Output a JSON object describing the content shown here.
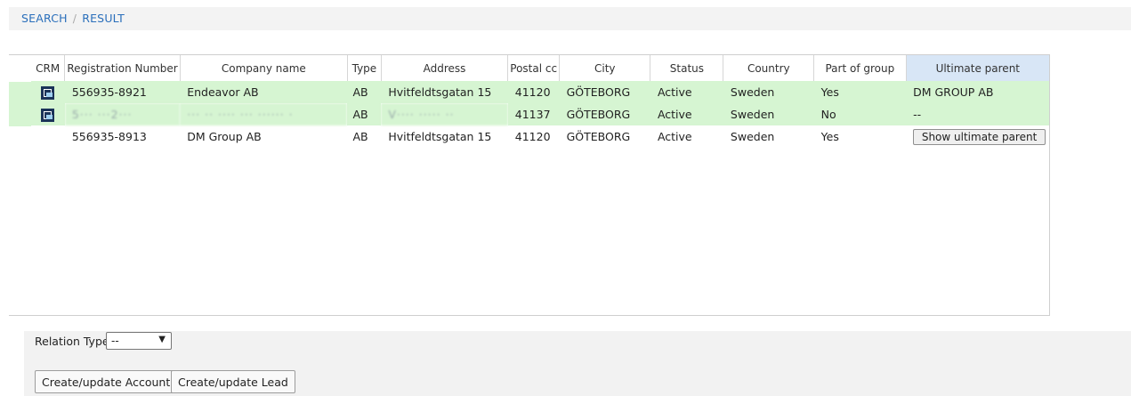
{
  "breadcrumb": {
    "search": "SEARCH",
    "separator": "/",
    "result": "RESULT"
  },
  "table": {
    "columns": [
      "CRM",
      "Registration Number",
      "Company name",
      "Type",
      "Address",
      "Postal code",
      "City",
      "Status",
      "Country",
      "Part of group",
      "Ultimate parent"
    ],
    "columns_display": [
      "CRM",
      "Registration Number",
      "Company name",
      "Type",
      "Address",
      "Postal cc",
      "City",
      "Status",
      "Country",
      "Part of group",
      "Ultimate parent"
    ],
    "rows": [
      {
        "crm_icon": "crm-logo-icon",
        "reg": "556935-8921",
        "name": "Endeavor AB",
        "type": "AB",
        "address": "Hvitfeldtsgatan 15",
        "postal": "41120",
        "city": "GÖTEBORG",
        "status": "Active",
        "country": "Sweden",
        "group": "Yes",
        "parent": "DM GROUP AB"
      },
      {
        "crm_icon": "crm-logo-icon",
        "reg": "5··· ···2···",
        "name": "··· ·· ···· ··· ······ ·",
        "type": "AB",
        "address": "V···· ····· ··",
        "postal": "41137",
        "city": "GÖTEBORG",
        "status": "Active",
        "country": "Sweden",
        "group": "No",
        "parent": "--"
      },
      {
        "crm_icon": "",
        "reg": "556935-8913",
        "name": "DM Group AB",
        "type": "AB",
        "address": "Hvitfeldtsgatan 15",
        "postal": "41120",
        "city": "GÖTEBORG",
        "status": "Active",
        "country": "Sweden",
        "group": "Yes",
        "parent_button": "Show ultimate parent"
      }
    ]
  },
  "relation": {
    "label": "Relation Type",
    "value": "--"
  },
  "actions": {
    "account": "Create/update Account",
    "lead": "Create/update Lead"
  },
  "colors": {
    "accent": "#2a6fbb",
    "row_highlight": "#d6f5d2",
    "header_highlight": "#d8e6f6"
  }
}
